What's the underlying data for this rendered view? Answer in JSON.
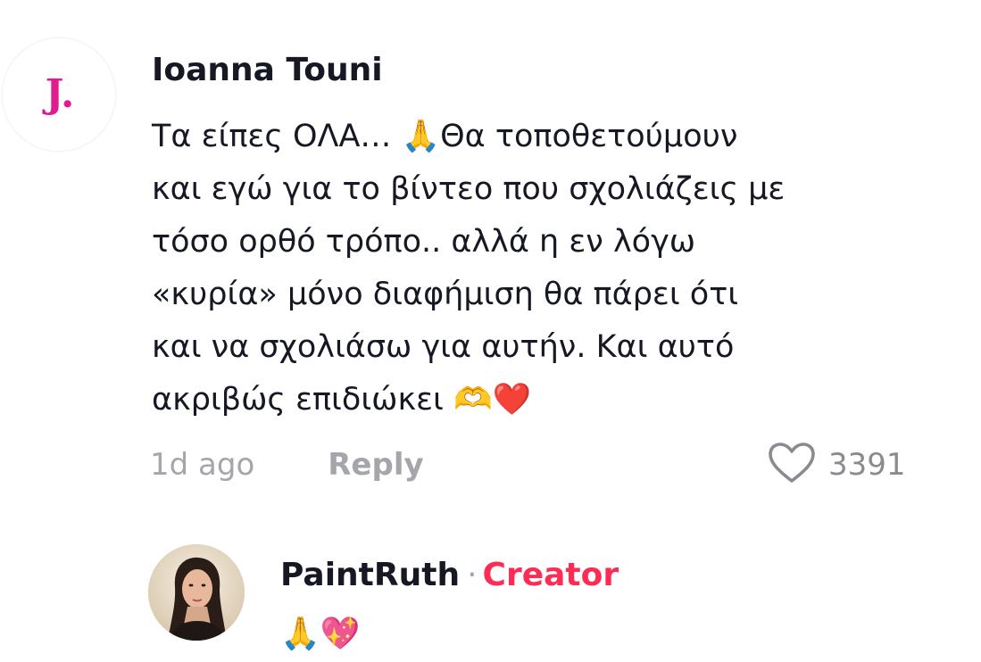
{
  "comment": {
    "avatar_initial": "J.",
    "username": "Ioanna Touni",
    "text_lines": [
      "Τα είπες ΟΛΑ… 🙏Θα τοποθετούμουν",
      "και εγώ για το βίντεο που σχολιάζεις με",
      "τόσο ορθό τρόπο.. αλλά η εν λόγω",
      "«κυρία» μόνο διαφήμιση θα πάρει ότι",
      "και να σχολιάσω για αυτήν. Και αυτό",
      "ακριβώς επιδιώκει 🫶❤️"
    ],
    "time": "1d ago",
    "reply_label": "Reply",
    "like_count": "3391",
    "like_icon": "heart-outline-icon"
  },
  "reply": {
    "username": "PaintRuth",
    "separator": "·",
    "badge": "Creator",
    "text": "🙏💖",
    "avatar_icon": "profile-photo"
  },
  "colors": {
    "text": "#161823",
    "muted": "#a4a6ab",
    "creator": "#fe2c55",
    "avatar_initial": "#e01c8f"
  }
}
